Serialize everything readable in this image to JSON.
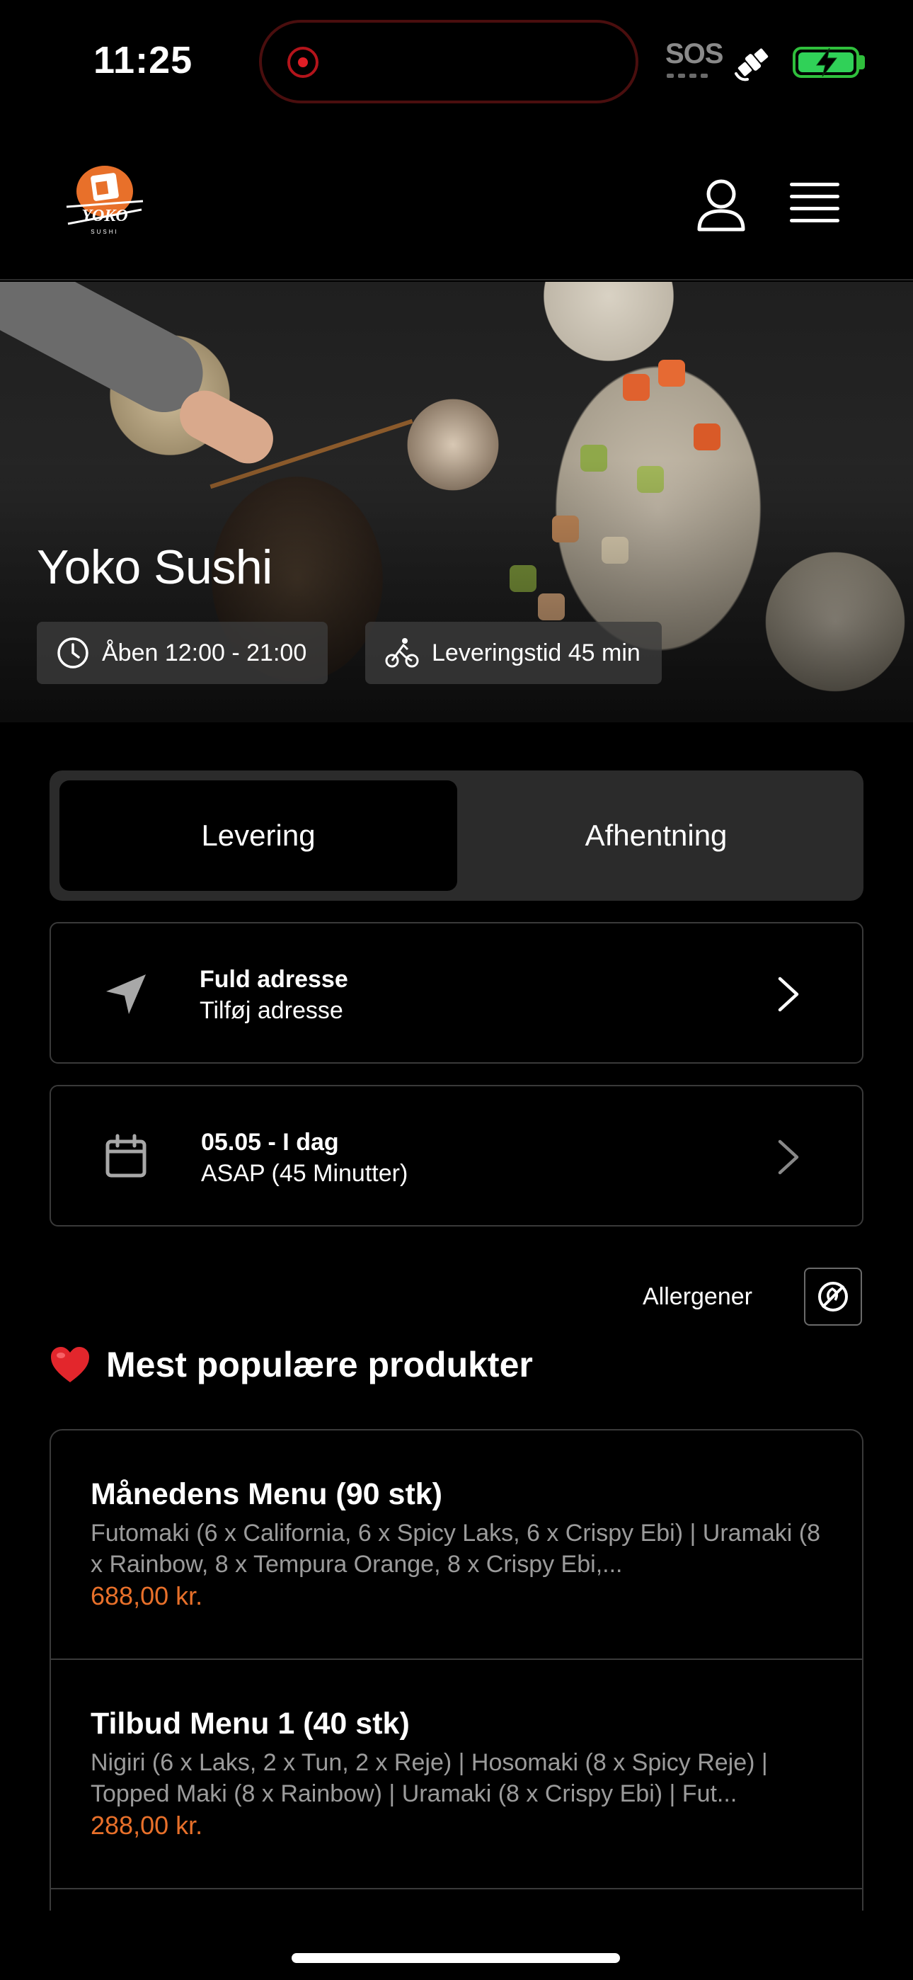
{
  "status_bar": {
    "time": "11:25",
    "sos": "SOS",
    "icons": [
      "recording-indicator-icon",
      "satellite-icon",
      "battery-charging-icon"
    ],
    "colors": {
      "recording": "#e01e26",
      "battery": "#30d158"
    }
  },
  "header": {
    "logo_text": "YOKO",
    "logo_subtext": "SUSHI",
    "icons": [
      "user-icon",
      "hamburger-menu-icon"
    ]
  },
  "hero": {
    "title": "Yoko Sushi",
    "opening_hours": "Åben 12:00 - 21:00",
    "delivery_time": "Leveringstid 45 min"
  },
  "order_mode": {
    "options": [
      "Levering",
      "Afhentning"
    ],
    "selected": "Levering"
  },
  "address_card": {
    "title": "Fuld adresse",
    "subtitle": "Tilføj adresse"
  },
  "time_card": {
    "title": "05.05 - I dag",
    "subtitle": "ASAP (45 Minutter)"
  },
  "allergens": {
    "label": "Allergener"
  },
  "popular": {
    "title": "Mest populære produkter",
    "products": [
      {
        "name": "Månedens Menu (90 stk)",
        "description": "Futomaki (6 x California, 6 x Spicy Laks, 6 x Crispy Ebi) | Uramaki (8 x Rainbow, 8 x Tempura Orange, 8 x Crispy Ebi,...",
        "price": "688,00 kr."
      },
      {
        "name": "Tilbud Menu 1 (40 stk)",
        "description": "Nigiri (6 x Laks, 2 x Tun, 2 x Reje) | Hosomaki (8 x Spicy Reje) | Topped Maki (8 x Rainbow) | Uramaki (8 x Crispy Ebi) | Fut...",
        "price": "288,00 kr."
      }
    ]
  },
  "colors": {
    "accent": "#e8702a",
    "background": "#000000",
    "surface": "#2b2b2b"
  }
}
